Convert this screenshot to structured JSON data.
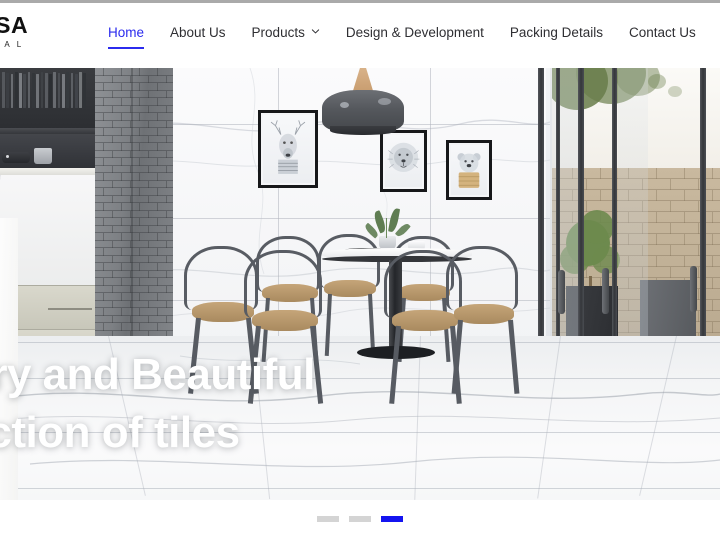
{
  "site": {
    "logo_main": "ASA",
    "logo_sub": "O N A L"
  },
  "nav": {
    "items": [
      {
        "label": "Home",
        "active": true,
        "has_dropdown": false,
        "icon": ""
      },
      {
        "label": "About Us",
        "active": false,
        "has_dropdown": false,
        "icon": ""
      },
      {
        "label": "Products",
        "active": false,
        "has_dropdown": true,
        "icon": "chevron-down-icon"
      },
      {
        "label": "Design & Development",
        "active": false,
        "has_dropdown": false,
        "icon": ""
      },
      {
        "label": "Packing Details",
        "active": false,
        "has_dropdown": false,
        "icon": ""
      },
      {
        "label": "Contact Us",
        "active": false,
        "has_dropdown": false,
        "icon": ""
      }
    ]
  },
  "hero": {
    "headline_line1": "xury and Beautiful",
    "headline_line2": "llection of tiles",
    "scene": {
      "description": "Modern dining room with marble-look tile floor and walls",
      "art_frames": [
        "deer-print",
        "lion-print",
        "bear-print"
      ],
      "fixtures": [
        "pendant-lamp",
        "dining-table",
        "wishbone-chairs",
        "sliding-glass-door",
        "potted-tree"
      ]
    }
  },
  "slider": {
    "dots": [
      {
        "active": false
      },
      {
        "active": false
      },
      {
        "active": true
      }
    ]
  },
  "colors": {
    "accent": "#2b2bee",
    "dot_active": "#1414f0",
    "dot_inactive": "#d4d4d4",
    "nav_text": "#2f2f33",
    "hero_text": "#ffffff"
  }
}
